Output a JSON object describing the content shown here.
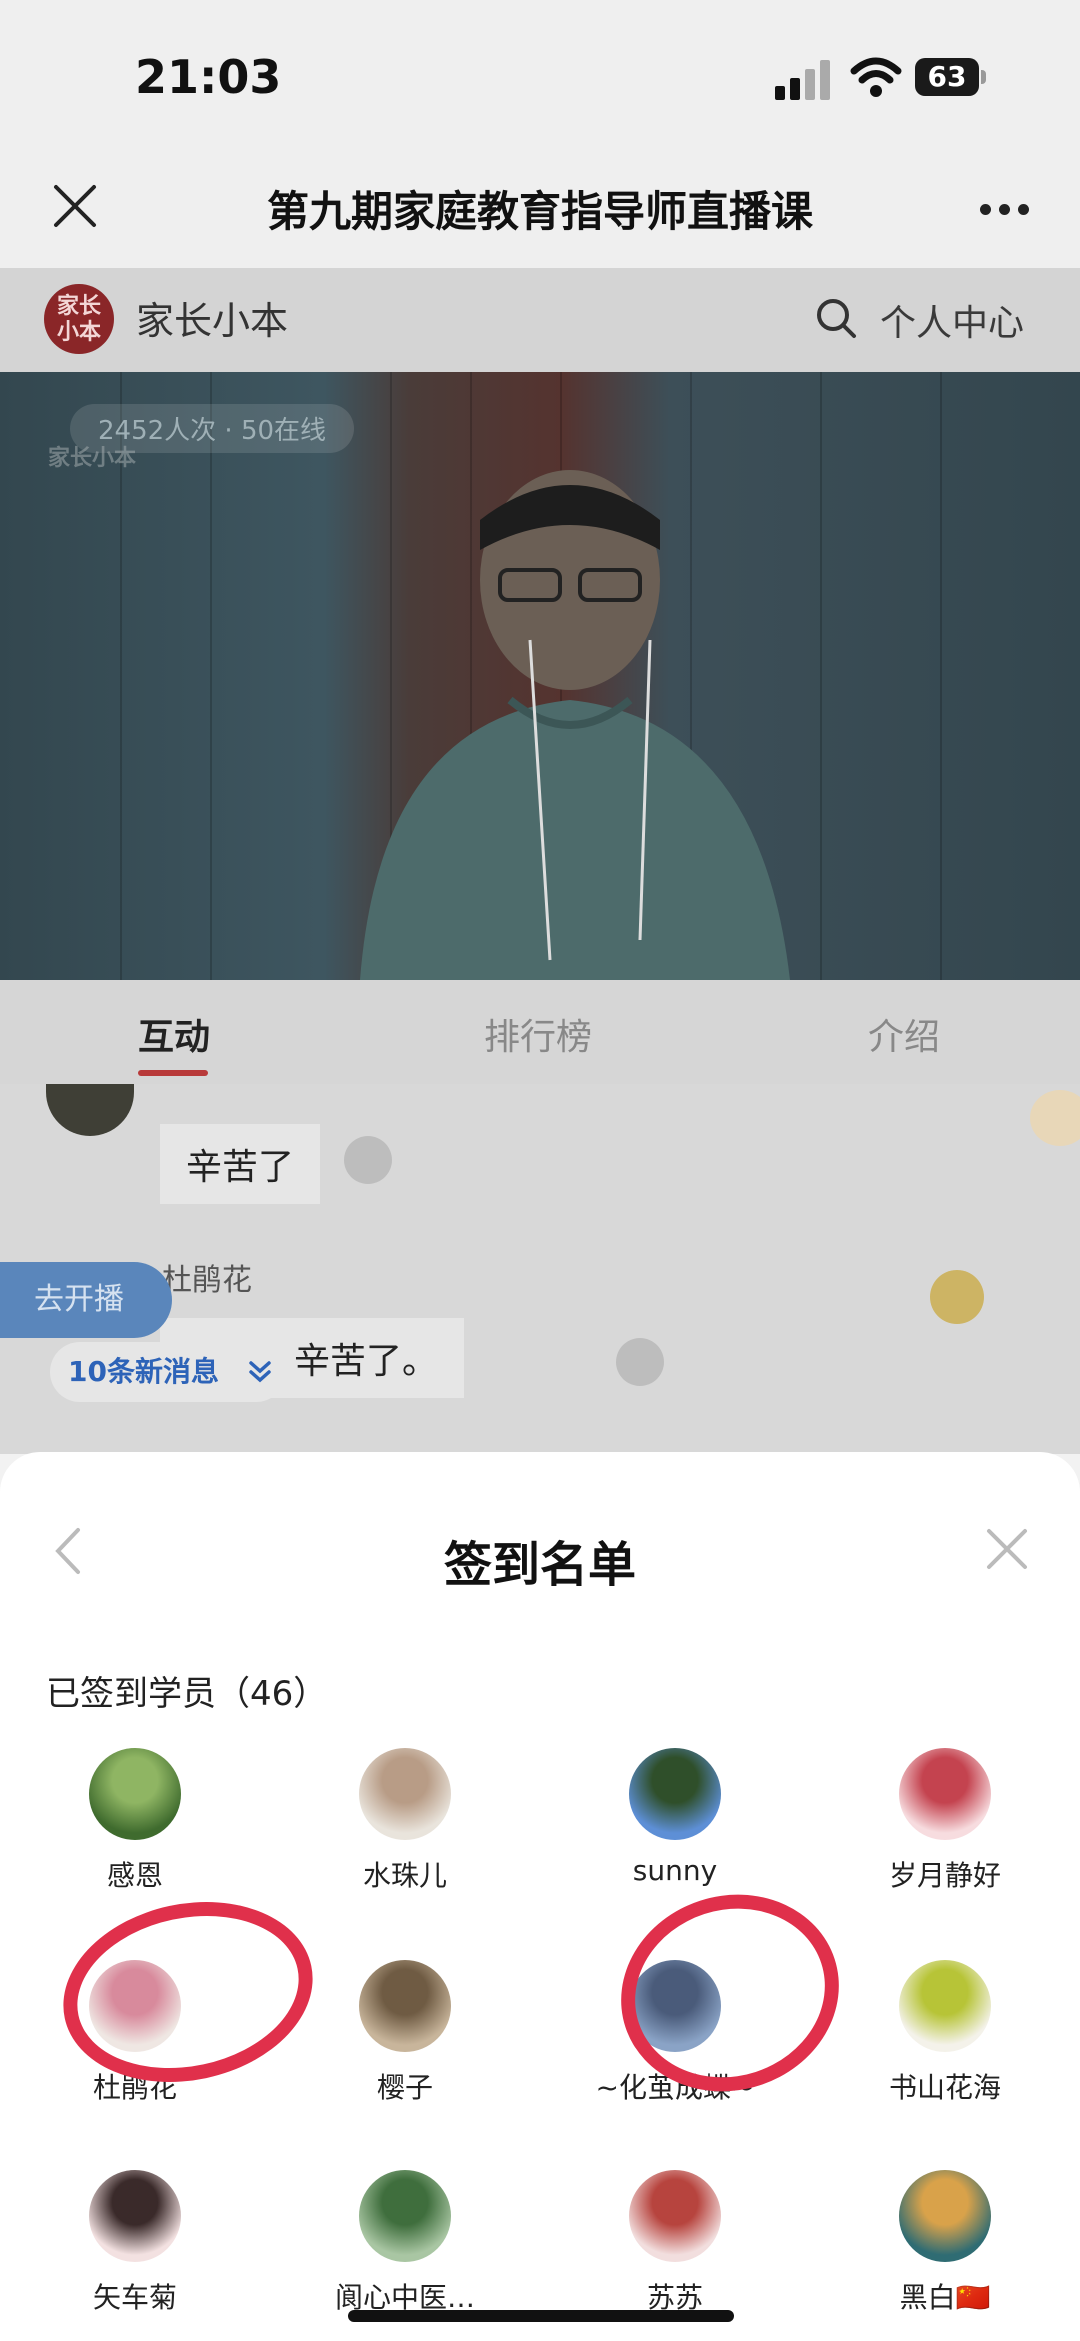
{
  "status_bar": {
    "time": "21:03",
    "battery": "63"
  },
  "nav": {
    "title": "第九期家庭教育指导师直播课"
  },
  "app_header": {
    "logo_text": "家长小本",
    "name": "家长小本",
    "personal_center": "个人中心"
  },
  "video": {
    "viewer_stats": "2452人次 · 50在线",
    "watermark": "家长小本"
  },
  "tabs": {
    "interact": "互动",
    "rank": "排行榜",
    "intro": "介绍"
  },
  "chat": {
    "message_1": "辛苦了",
    "user_2": "杜鹃花",
    "message_2": "校长，辛苦了。",
    "go_live": "去开播",
    "new_messages": "10条新消息"
  },
  "sheet": {
    "title": "签到名单",
    "signed_label": "已签到学员（46）",
    "members": [
      {
        "name": "感恩",
        "colors": [
          "#3f6b2e",
          "#8fb563"
        ]
      },
      {
        "name": "水珠儿",
        "colors": [
          "#e9e4dc",
          "#b89c86"
        ]
      },
      {
        "name": "sunny",
        "colors": [
          "#5d8fd6",
          "#2f4f2a"
        ]
      },
      {
        "name": "岁月静好",
        "colors": [
          "#f7dcdf",
          "#c4434f"
        ]
      },
      {
        "name": "杜鹃花",
        "colors": [
          "#efe7e3",
          "#d88a9c"
        ]
      },
      {
        "name": "樱子",
        "colors": [
          "#c8b59b",
          "#6f5b43"
        ]
      },
      {
        "name": "~化茧成蝶~",
        "colors": [
          "#8aa3c6",
          "#4a5b7a"
        ]
      },
      {
        "name": "书山花海",
        "colors": [
          "#f4f2ea",
          "#b7c437"
        ]
      },
      {
        "name": "矢车菊",
        "colors": [
          "#f3e1e1",
          "#3a2a2a"
        ]
      },
      {
        "name": "阆心中医…",
        "colors": [
          "#a9c6a3",
          "#3f6e3d"
        ]
      },
      {
        "name": "苏苏",
        "colors": [
          "#f2dede",
          "#b7443e"
        ]
      },
      {
        "name": "黑白🇨🇳",
        "colors": [
          "#2f6c73",
          "#d9a24a"
        ]
      }
    ]
  }
}
